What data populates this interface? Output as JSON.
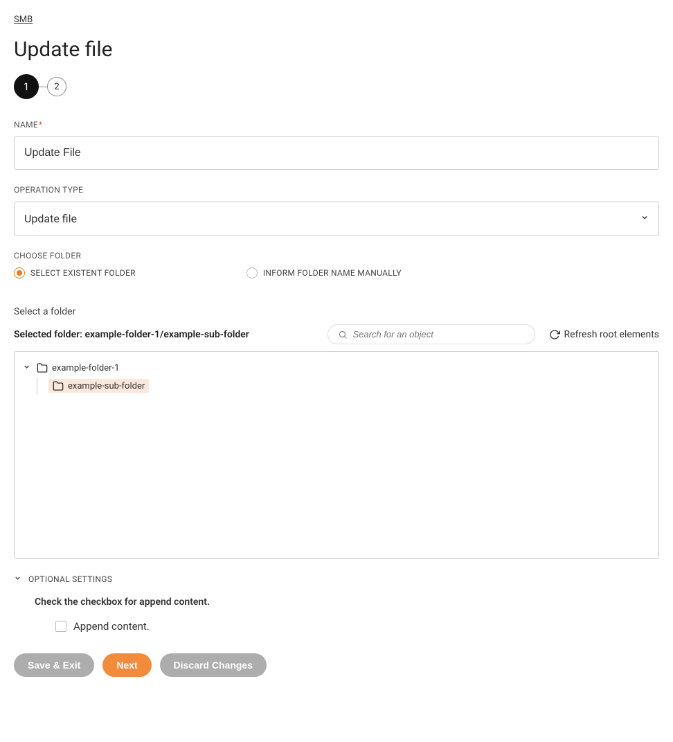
{
  "breadcrumb": "SMB",
  "page_title": "Update file",
  "stepper": {
    "step1": "1",
    "step2": "2"
  },
  "name_field": {
    "label": "NAME",
    "required": "*",
    "value": "Update File"
  },
  "operation_type": {
    "label": "OPERATION TYPE",
    "value": "Update file"
  },
  "choose_folder": {
    "label": "CHOOSE FOLDER",
    "option_existing": "SELECT EXISTENT FOLDER",
    "option_manual": "INFORM FOLDER NAME MANUALLY"
  },
  "folder_section": {
    "subheader": "Select a folder",
    "selected_prefix": "Selected folder: ",
    "selected_path": "example-folder-1/example-sub-folder",
    "search_placeholder": "Search for an object",
    "refresh_label": "Refresh root elements"
  },
  "tree": {
    "root": "example-folder-1",
    "child": "example-sub-folder"
  },
  "optional": {
    "header": "OPTIONAL SETTINGS",
    "description": "Check the checkbox for append content.",
    "checkbox_label": "Append content."
  },
  "buttons": {
    "save_exit": "Save & Exit",
    "next": "Next",
    "discard": "Discard Changes"
  }
}
